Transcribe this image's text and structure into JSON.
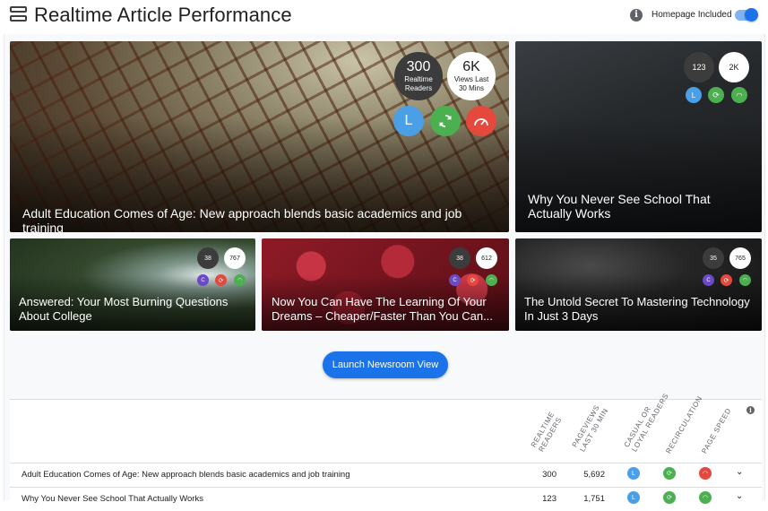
{
  "header": {
    "title": "Realtime Article Performance",
    "toggle_label": "Homepage Included",
    "toggle_on": true
  },
  "icons": {
    "menu": "menu-icon",
    "info": "info-icon",
    "loyal": "L",
    "casual": "C",
    "recirculation": "recirculation-icon",
    "page_speed": "speedometer-icon"
  },
  "colors": {
    "accent": "#1a73e8",
    "loyal": "#4a9fe6",
    "recirculation": "#4caf50",
    "speed": "#e5493e",
    "casual": "#6a4bc4"
  },
  "cards": [
    {
      "title": "Adult Education Comes of Age: New approach blends basic academics and job training",
      "readers": "300",
      "readers_label": "Realtime Readers",
      "views": "6K",
      "views_label": "Views Last 30 Mins",
      "reader_type": "L"
    },
    {
      "title": "Why You Never See School That Actually Works",
      "readers": "123",
      "views": "2K",
      "reader_type": "L"
    },
    {
      "title": "Answered: Your Most Burning Questions About College",
      "readers": "38",
      "views": "767",
      "reader_type": "C"
    },
    {
      "title": "Now You Can Have The Learning Of Your Dreams – Cheaper/Faster Than You Can...",
      "readers": "38",
      "views": "612",
      "reader_type": "C"
    },
    {
      "title": "The Untold Secret To Mastering Technology In Just 3 Days",
      "readers": "35",
      "views": "765",
      "reader_type": "C"
    }
  ],
  "launch_button": "Launch Newsroom View",
  "table": {
    "columns": [
      "REALTIME READERS",
      "PAGEVIEWS LAST 30 MIN",
      "CASUAL OR LOYAL READERS",
      "RECIRCULATION",
      "PAGE SPEED"
    ],
    "rows": [
      {
        "title": "Adult Education Comes of Age: New approach blends basic academics and job training",
        "readers": "300",
        "pageviews": "5,692",
        "reader_type": "L"
      },
      {
        "title": "Why You Never See School That Actually Works",
        "readers": "123",
        "pageviews": "1,751",
        "reader_type": "L"
      }
    ]
  }
}
